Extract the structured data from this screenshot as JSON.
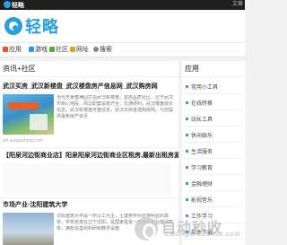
{
  "topbar": {
    "logo": "轻略",
    "right": "文章"
  },
  "header": {
    "logo_text": "轻略"
  },
  "nav": {
    "items": [
      {
        "label": "应用",
        "color": "#e05a2a"
      },
      {
        "label": "游戏",
        "color": "#2a9fe0"
      },
      {
        "label": "社区",
        "color": "#5aaa3a"
      },
      {
        "label": "网址",
        "color": "#e0a02a"
      },
      {
        "label": "搜索",
        "color": "#888888"
      }
    ]
  },
  "left": {
    "section_title": "资讯+社区",
    "articles": [
      {
        "title": "武汉买房_武汉新楼盘_武汉楼盘房产信息网_武汉购房网",
        "excerpt": "当代天景春满园打造武汉新楼盘，宜居品质社区，位于武汉市核心地段，周边配套设施齐全，交通便利，武汉楼盘房价信息，武汉新楼盘开盘信息，武汉买房首选购房网，为您提供最新房产资讯",
        "meta": "wh.yuegoufang.com"
      },
      {
        "title": "【阳泉河边街商业店】阳泉阳泉河边街商业区租房,最新出租房源,租金走势信息",
        "excerpt": "",
        "meta": ""
      },
      {
        "title": "市场产业-沈阳建筑大学",
        "excerpt": "沈阳建筑大学是一所以工为主，土建类学科优势明显的高校，学校坐落在辽宁沈阳，是国家首批一流本科专业建设高校，拥有完善的科研和教学设施",
        "meta": ""
      }
    ]
  },
  "right": {
    "section_title": "应用",
    "items": [
      "常用小工具",
      "在线转换",
      "站长工具",
      "休闲娱乐",
      "生活服务",
      "学习教育",
      "金融理财",
      "影视音乐",
      "工作学习",
      "软件下载"
    ]
  },
  "watermark": {
    "main": "自动秒收",
    "sub": "zidongmiaoshou.com"
  },
  "colors": {
    "accent": "#2a9fe0"
  }
}
